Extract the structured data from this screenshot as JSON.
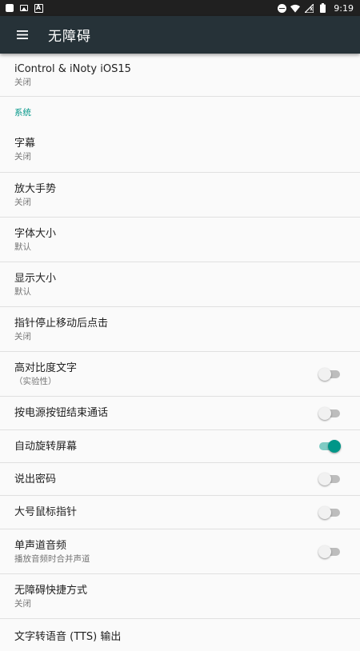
{
  "status_bar": {
    "time": "9:19",
    "notification_letter": "A"
  },
  "app_bar": {
    "title": "无障碍",
    "menu_icon": "hamburger-menu-icon"
  },
  "colors": {
    "accent": "#009688",
    "app_bar_bg": "#263238",
    "status_bar_bg": "#202020"
  },
  "services": [
    {
      "title": "iControl & iNoty iOS15",
      "subtitle": "关闭"
    }
  ],
  "system_section": {
    "header": "系统"
  },
  "system_items": [
    {
      "title": "字幕",
      "subtitle": "关闭"
    },
    {
      "title": "放大手势",
      "subtitle": "关闭"
    },
    {
      "title": "字体大小",
      "subtitle": "默认"
    },
    {
      "title": "显示大小",
      "subtitle": "默认"
    },
    {
      "title": "指针停止移动后点击",
      "subtitle": "关闭"
    }
  ],
  "toggles": [
    {
      "title": "高对比度文字",
      "subtitle": "（实验性）",
      "on": false
    },
    {
      "title": "按电源按钮结束通话",
      "on": false
    },
    {
      "title": "自动旋转屏幕",
      "on": true
    },
    {
      "title": "说出密码",
      "on": false
    },
    {
      "title": "大号鼠标指针",
      "on": false
    },
    {
      "title": "单声道音频",
      "subtitle": "播放音频时合并声道",
      "on": false
    }
  ],
  "bottom_items": [
    {
      "title": "无障碍快捷方式",
      "subtitle": "关闭"
    },
    {
      "title": "文字转语音 (TTS) 输出"
    }
  ]
}
